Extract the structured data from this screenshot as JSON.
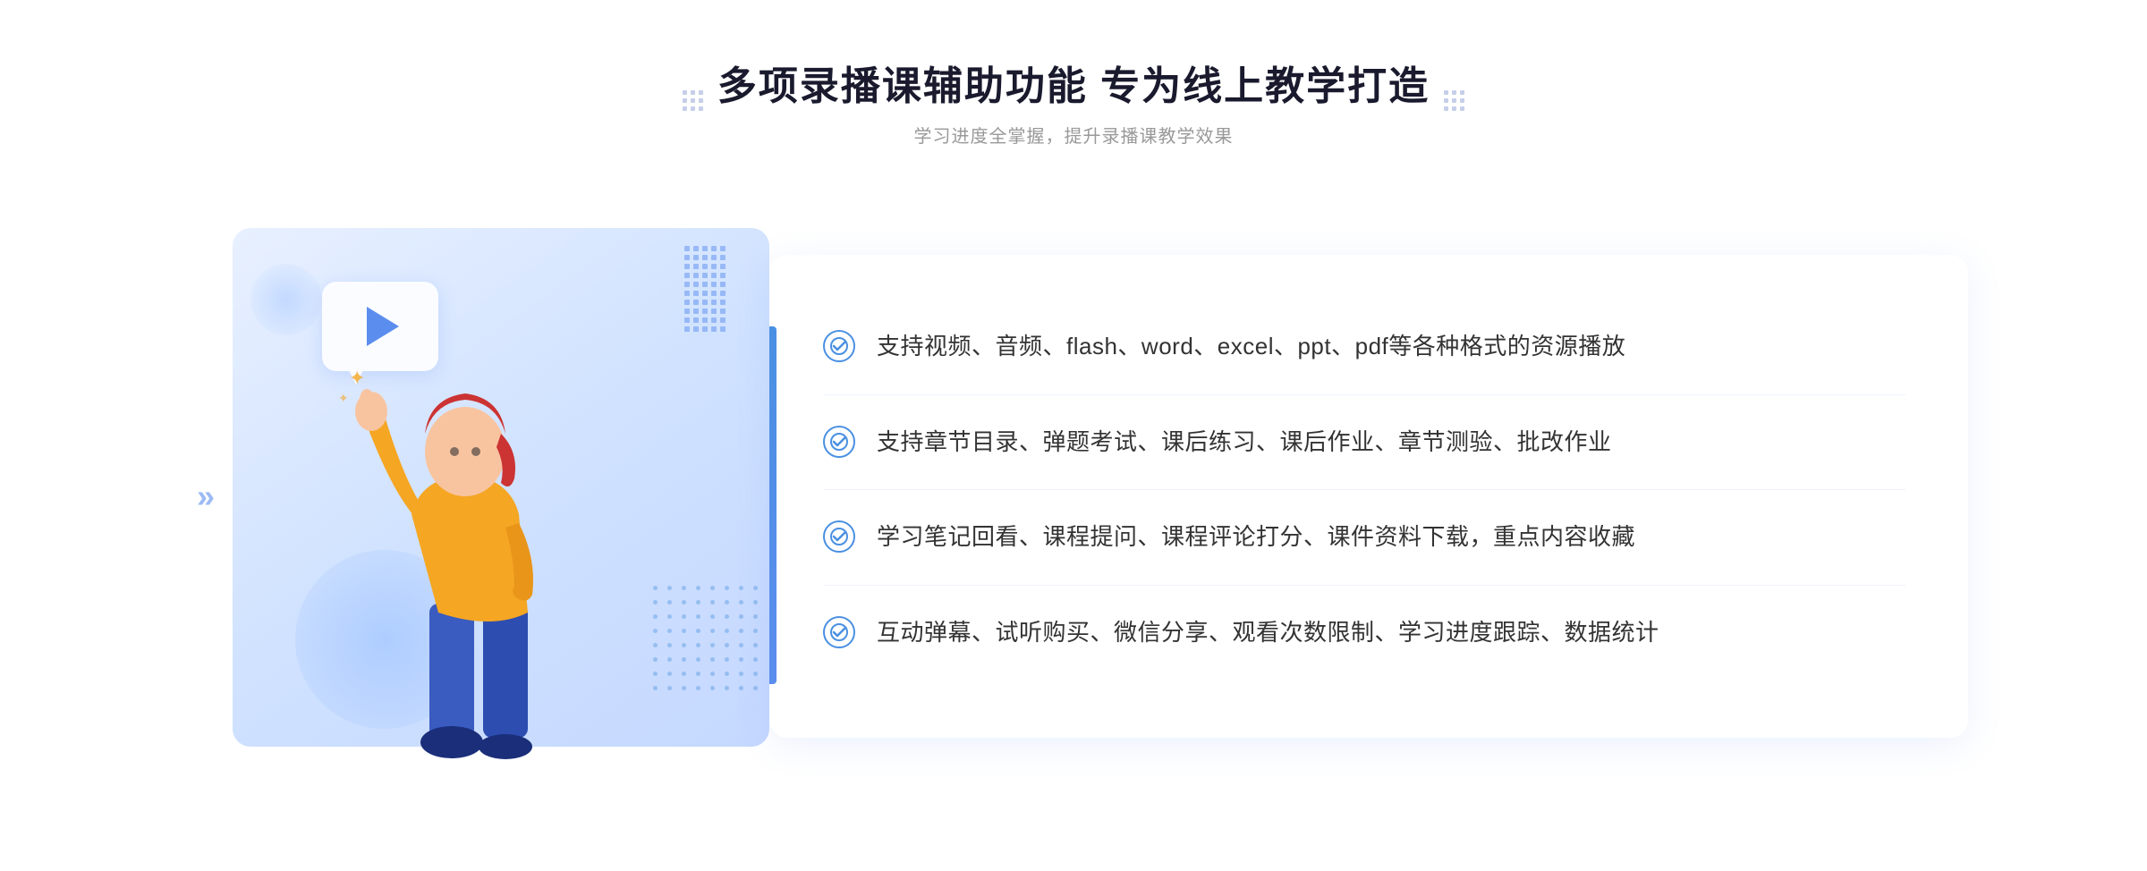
{
  "header": {
    "title": "多项录播课辅助功能 专为线上教学打造",
    "subtitle": "学习进度全掌握，提升录播课教学效果",
    "dots_left_label": "decorative-dots-left",
    "dots_right_label": "decorative-dots-right"
  },
  "features": [
    {
      "id": 1,
      "text": "支持视频、音频、flash、word、excel、ppt、pdf等各种格式的资源播放"
    },
    {
      "id": 2,
      "text": "支持章节目录、弹题考试、课后练习、课后作业、章节测验、批改作业"
    },
    {
      "id": 3,
      "text": "学习笔记回看、课程提问、课程评论打分、课件资料下载，重点内容收藏"
    },
    {
      "id": 4,
      "text": "互动弹幕、试听购买、微信分享、观看次数限制、学习进度跟踪、数据统计"
    }
  ],
  "illustration": {
    "play_button_label": "play-icon",
    "chevron_left_label": "»"
  },
  "colors": {
    "primary_blue": "#4a90e2",
    "accent_blue": "#5b8dee",
    "light_blue_bg": "#e8f0ff",
    "text_dark": "#1a1a2e",
    "text_gray": "#999999",
    "text_body": "#333333"
  }
}
